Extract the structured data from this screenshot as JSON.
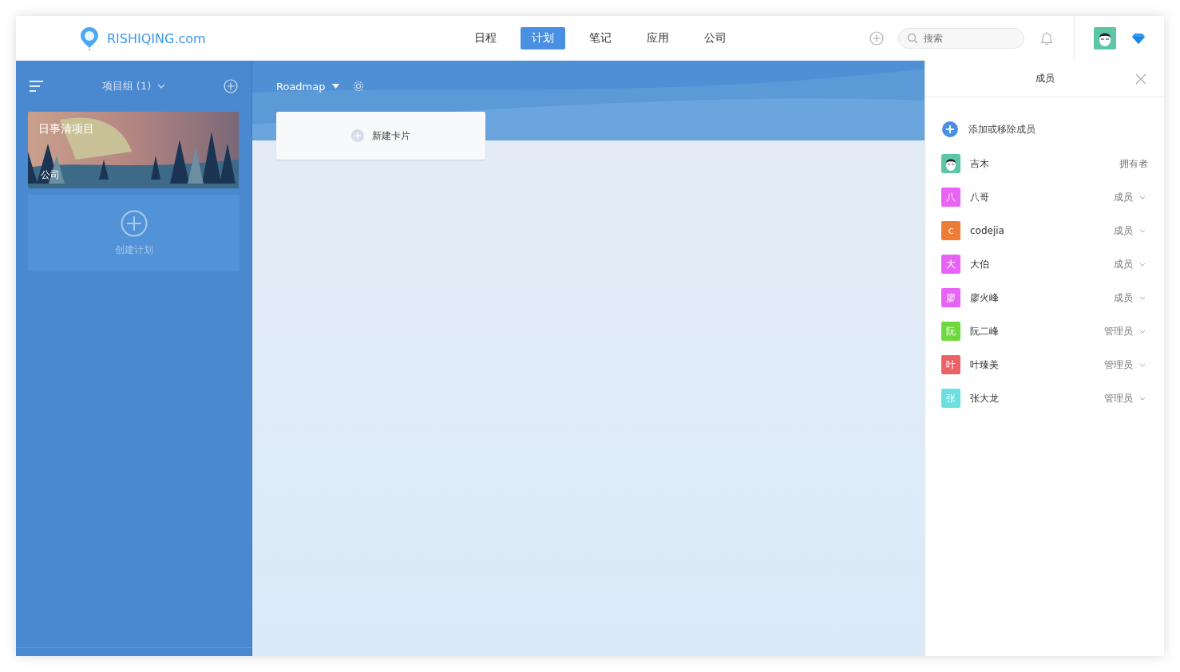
{
  "header": {
    "logo_text": "RISHIQING.com",
    "nav": [
      {
        "label": "日程",
        "selected": false
      },
      {
        "label": "计划",
        "selected": true
      },
      {
        "label": "笔记",
        "selected": false
      },
      {
        "label": "应用",
        "selected": false
      },
      {
        "label": "公司",
        "selected": false
      }
    ],
    "search": {
      "placeholder": "搜索"
    }
  },
  "sidebar": {
    "group_label": "项目组 (1)",
    "projects": [
      {
        "title": "日事清项目",
        "subtitle": "公司"
      }
    ],
    "create_label": "创建计划"
  },
  "board": {
    "title": "Roadmap",
    "new_card_label": "新建卡片"
  },
  "members_panel": {
    "title": "成员",
    "add_label": "添加或移除成员",
    "members": [
      {
        "kind": "photo",
        "name": "吉木",
        "role": "拥有者",
        "dropdown": false,
        "color": "#5cc6a7"
      },
      {
        "kind": "letter",
        "initial": "八",
        "name": "八哥",
        "role": "成员",
        "dropdown": true,
        "color": "#e863f5"
      },
      {
        "kind": "letter",
        "initial": "c",
        "name": "codejia",
        "role": "成员",
        "dropdown": true,
        "color": "#ef7c35"
      },
      {
        "kind": "letter",
        "initial": "大",
        "name": "大伯",
        "role": "成员",
        "dropdown": true,
        "color": "#e863f5"
      },
      {
        "kind": "letter",
        "initial": "廖",
        "name": "廖火峰",
        "role": "成员",
        "dropdown": true,
        "color": "#e863f5"
      },
      {
        "kind": "letter",
        "initial": "阮",
        "name": "阮二峰",
        "role": "管理员",
        "dropdown": true,
        "color": "#70d83f"
      },
      {
        "kind": "letter",
        "initial": "叶",
        "name": "叶臻美",
        "role": "管理员",
        "dropdown": true,
        "color": "#ea6266"
      },
      {
        "kind": "letter",
        "initial": "张",
        "name": "张大龙",
        "role": "管理员",
        "dropdown": true,
        "color": "#6ae0e0"
      }
    ]
  }
}
